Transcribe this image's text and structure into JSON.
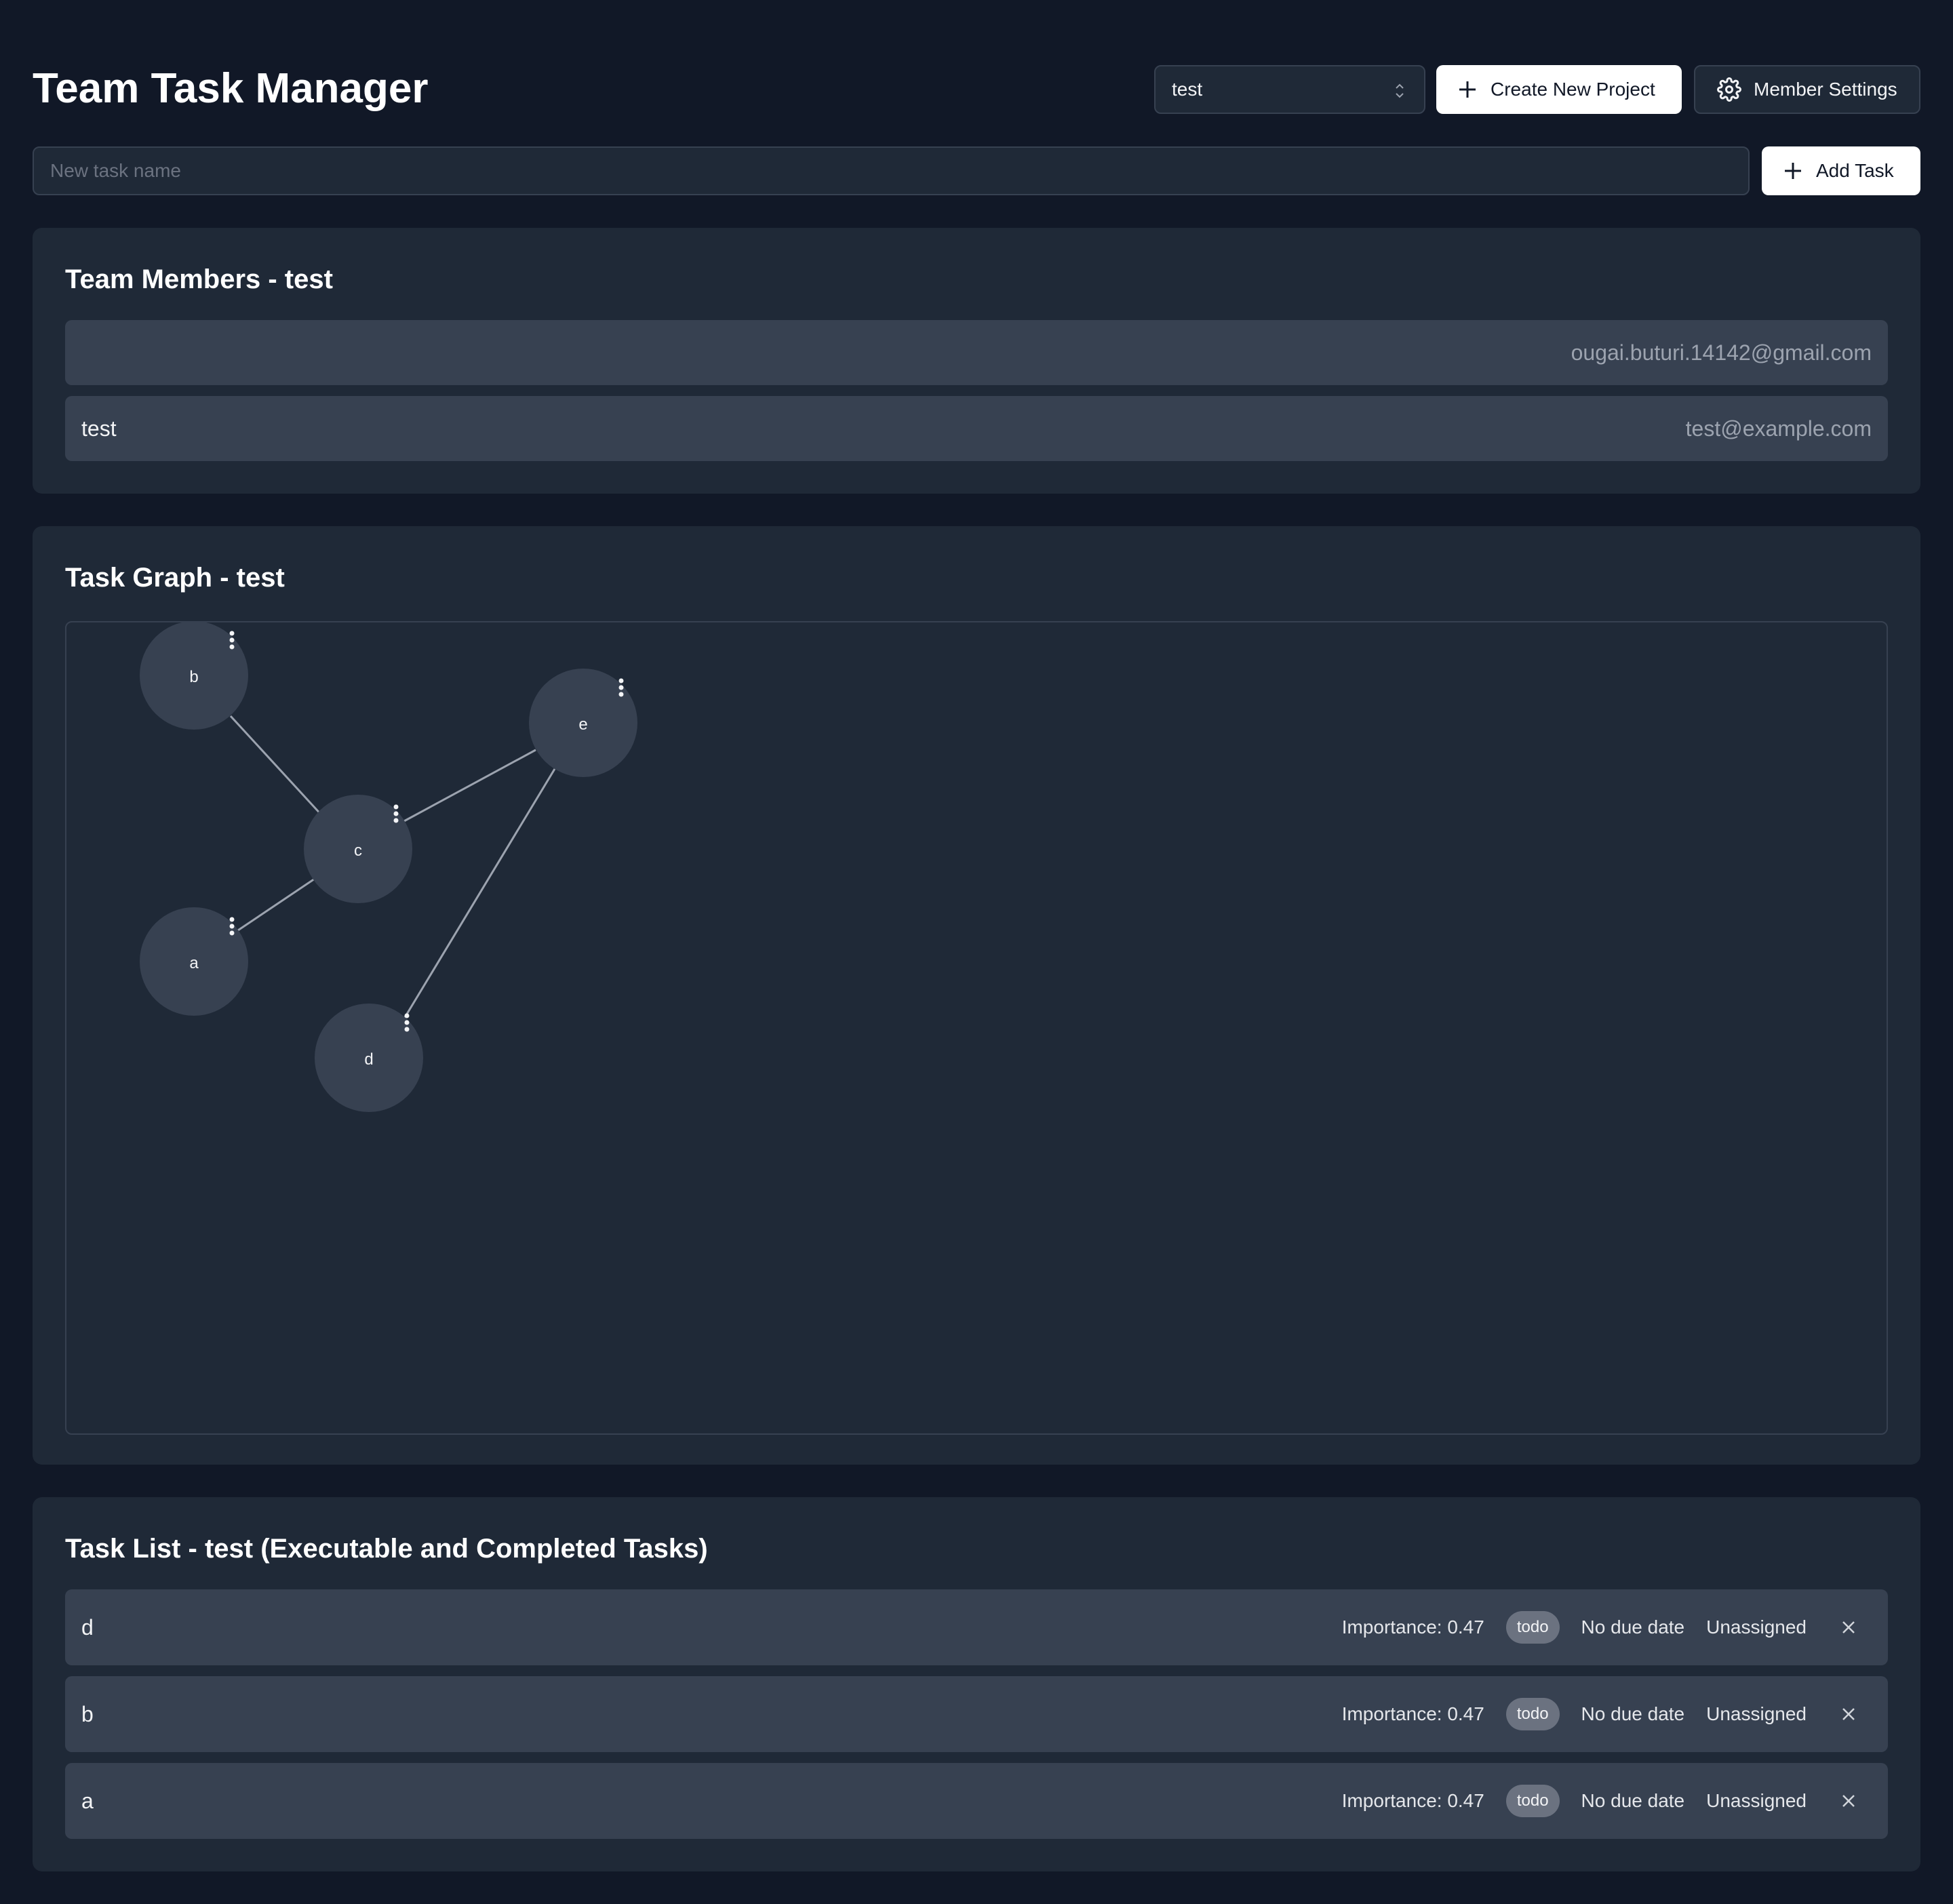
{
  "header": {
    "title": "Team Task Manager",
    "project_select": {
      "value": "test"
    },
    "create_project_label": "Create New Project",
    "member_settings_label": "Member Settings"
  },
  "task_input": {
    "placeholder": "New task name",
    "value": ""
  },
  "add_task_label": "Add Task",
  "members_card": {
    "title": "Team Members - test",
    "members": [
      {
        "name": "",
        "email": "ougai.buturi.14142@gmail.com"
      },
      {
        "name": "test",
        "email": "test@example.com"
      }
    ]
  },
  "graph_card": {
    "title": "Task Graph - test",
    "nodes": [
      {
        "id": "b",
        "label": "b"
      },
      {
        "id": "e",
        "label": "e"
      },
      {
        "id": "c",
        "label": "c"
      },
      {
        "id": "a",
        "label": "a"
      },
      {
        "id": "d",
        "label": "d"
      }
    ],
    "edges": [
      {
        "from": "b",
        "to": "c"
      },
      {
        "from": "e",
        "to": "c"
      },
      {
        "from": "a",
        "to": "c"
      },
      {
        "from": "e",
        "to": "d"
      }
    ]
  },
  "task_list_card": {
    "title": "Task List - test (Executable and Completed Tasks)",
    "tasks": [
      {
        "name": "d",
        "importance": "Importance: 0.47",
        "status": "todo",
        "due": "No due date",
        "assignee": "Unassigned"
      },
      {
        "name": "b",
        "importance": "Importance: 0.47",
        "status": "todo",
        "due": "No due date",
        "assignee": "Unassigned"
      },
      {
        "name": "a",
        "importance": "Importance: 0.47",
        "status": "todo",
        "due": "No due date",
        "assignee": "Unassigned"
      }
    ]
  },
  "colors": {
    "background": "#111827",
    "card": "#1f2937",
    "row": "#374151",
    "node": "#374151",
    "edge": "#9ca3af",
    "badge": "#6b7280"
  },
  "icons": [
    "chevron-up-down-icon",
    "plus-icon",
    "gear-icon",
    "more-vertical-icon",
    "close-icon"
  ]
}
